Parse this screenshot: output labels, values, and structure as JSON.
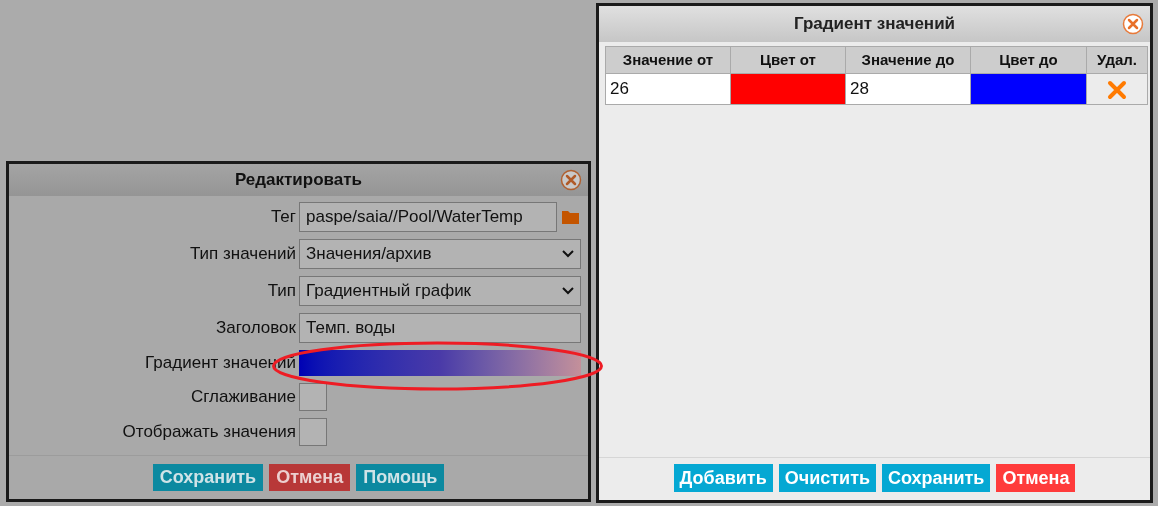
{
  "editor": {
    "title": "Редактировать",
    "fields": [
      {
        "kind": "text",
        "label": "Тег",
        "value": "paspe/saia//Pool/WaterTemp"
      },
      {
        "kind": "select",
        "label": "Тип значений",
        "value": "Значения/архив"
      },
      {
        "kind": "select",
        "label": "Тип",
        "value": "Градиентный график"
      },
      {
        "kind": "text",
        "label": "Заголовок",
        "value": "Темп. воды"
      },
      {
        "kind": "gradient",
        "label": "Градиент значений"
      },
      {
        "kind": "checkbox",
        "label": "Сглаживание",
        "checked": false
      },
      {
        "kind": "checkbox",
        "label": "Отображать значения",
        "checked": false
      }
    ],
    "buttons": [
      {
        "label": "Сохранить",
        "kind": "primary"
      },
      {
        "label": "Отмена",
        "kind": "danger"
      },
      {
        "label": "Помощь",
        "kind": "primary"
      }
    ]
  },
  "gradient_dialog": {
    "title": "Градиент значений",
    "columns": [
      "Значение от",
      "Цвет от",
      "Значение до",
      "Цвет до",
      "Удал."
    ],
    "rows": [
      {
        "from": {
          "value": "26",
          "color": "#ff0000"
        },
        "to": {
          "value": "28",
          "color": "#0000ff"
        }
      }
    ],
    "buttons": [
      {
        "label": "Добавить",
        "kind": "primary"
      },
      {
        "label": "Очистить",
        "kind": "primary"
      },
      {
        "label": "Сохранить",
        "kind": "primary"
      },
      {
        "label": "Отмена",
        "kind": "danger"
      }
    ]
  }
}
